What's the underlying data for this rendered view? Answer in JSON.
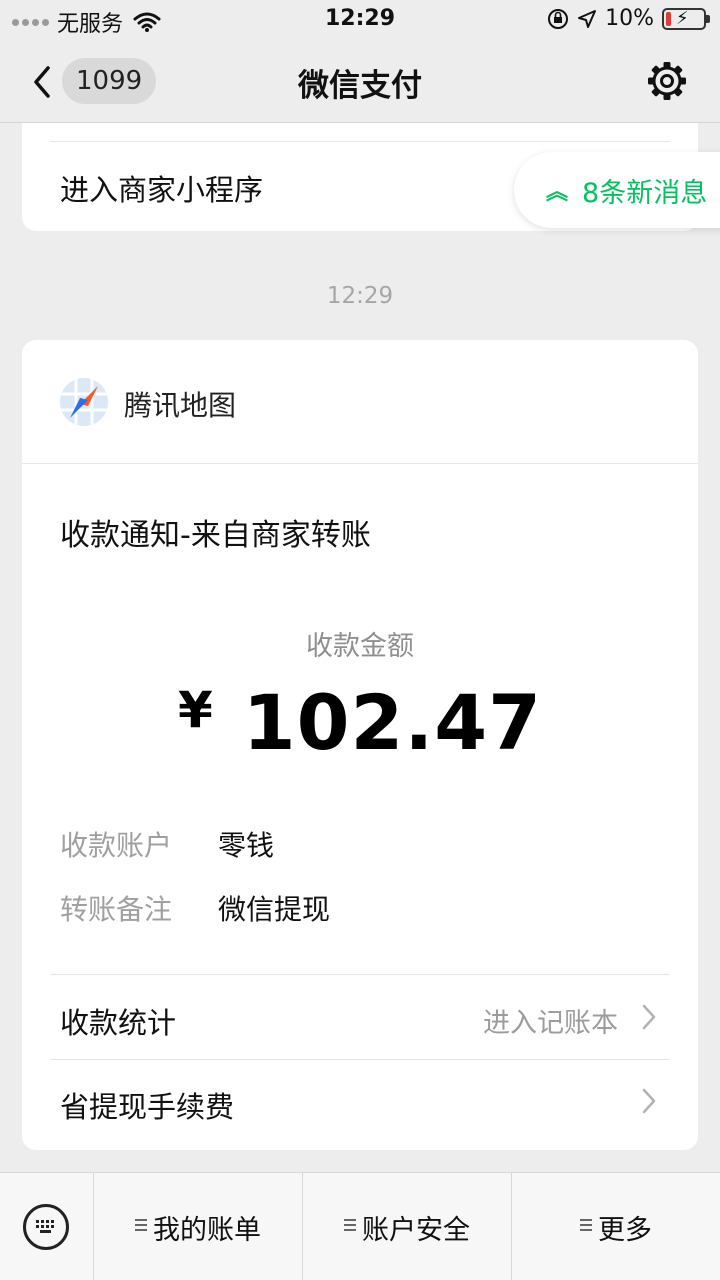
{
  "status_bar": {
    "carrier": "无服务",
    "time": "12:29",
    "battery_percent": "10%"
  },
  "nav": {
    "unread_count": "1099",
    "title": "微信支付"
  },
  "prev_card": {
    "label": "进入商家小程序"
  },
  "new_messages": {
    "label": "8条新消息"
  },
  "timestamp": "12:29",
  "payment_card": {
    "mini_program_name": "腾讯地图",
    "notice_title": "收款通知-来自商家转账",
    "amount_label": "收款金额",
    "currency": "¥",
    "amount": "102.47",
    "details": [
      {
        "key": "收款账户",
        "value": "零钱"
      },
      {
        "key": "转账备注",
        "value": "微信提现"
      }
    ],
    "stats_row": {
      "title": "收款统计",
      "hint": "进入记账本"
    },
    "fee_row": {
      "title": "省提现手续费"
    }
  },
  "bottom_menu": [
    {
      "label": "我的账单"
    },
    {
      "label": "账户安全"
    },
    {
      "label": "更多"
    }
  ],
  "colors": {
    "accent_green": "#07c160",
    "background": "#ededed",
    "card": "#ffffff"
  }
}
